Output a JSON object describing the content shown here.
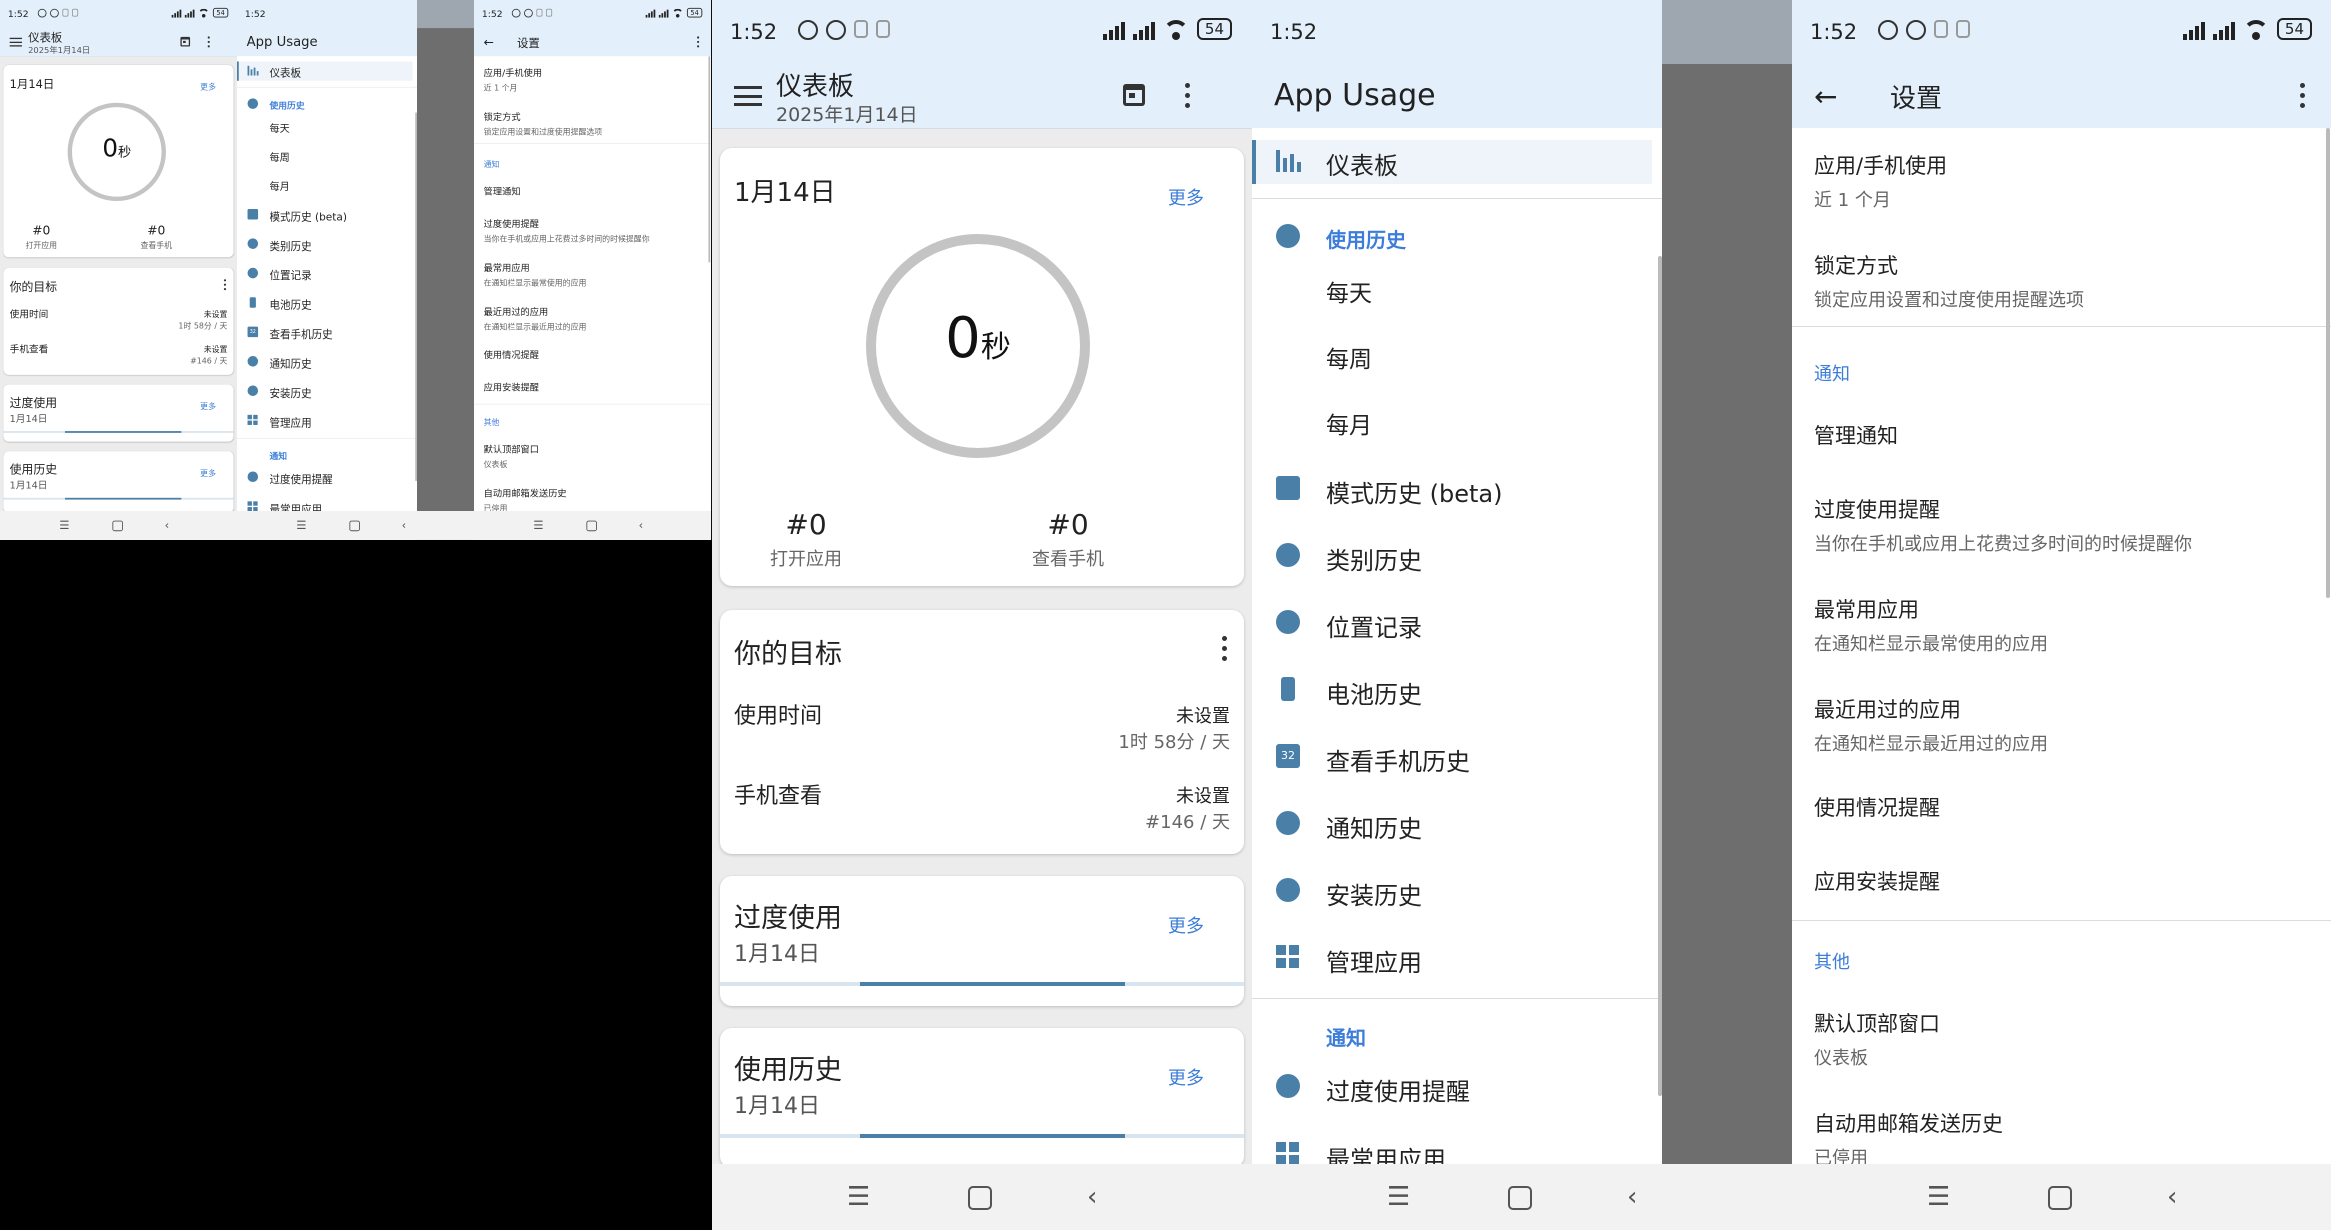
{
  "status": {
    "time": "1:52",
    "battery": "54"
  },
  "dashboard": {
    "title": "仪表板",
    "date_sub": "2025年1月14日",
    "today": {
      "date": "1月14日",
      "more": "更多",
      "value": "0",
      "unit": "秒",
      "opens_num": "#0",
      "opens_label": "打开应用",
      "checks_num": "#0",
      "checks_label": "查看手机"
    },
    "goals": {
      "title": "你的目标",
      "usage_label": "使用时间",
      "usage_status": "未设置",
      "usage_sub": "1时 58分 / 天",
      "checks_label": "手机查看",
      "checks_status": "未设置",
      "checks_sub": "#146 / 天"
    },
    "overuse": {
      "title": "过度使用",
      "date": "1月14日",
      "more": "更多"
    },
    "history": {
      "title": "使用历史",
      "date": "1月14日",
      "more": "更多"
    }
  },
  "drawer": {
    "title": "App Usage",
    "items": [
      {
        "label": "仪表板"
      },
      {
        "label": "使用历史"
      },
      {
        "label": "每天"
      },
      {
        "label": "每周"
      },
      {
        "label": "每月"
      },
      {
        "label": "模式历史 (beta)"
      },
      {
        "label": "类别历史"
      },
      {
        "label": "位置记录"
      },
      {
        "label": "电池历史"
      },
      {
        "label": "查看手机历史"
      },
      {
        "label": "通知历史"
      },
      {
        "label": "安装历史"
      },
      {
        "label": "管理应用"
      },
      {
        "label": "通知"
      },
      {
        "label": "过度使用提醒"
      },
      {
        "label": "最常用应用"
      }
    ],
    "calendar_badge": "32"
  },
  "settings": {
    "title": "设置",
    "items": [
      {
        "title": "应用/手机使用",
        "summary": "近 1 个月"
      },
      {
        "title": "锁定方式",
        "summary": "锁定应用设置和过度使用提醒选项"
      },
      {
        "title": "管理通知",
        "summary": ""
      },
      {
        "title": "过度使用提醒",
        "summary": "当你在手机或应用上花费过多时间的时候提醒你"
      },
      {
        "title": "最常用应用",
        "summary": "在通知栏显示最常使用的应用"
      },
      {
        "title": "最近用过的应用",
        "summary": "在通知栏显示最近用过的应用"
      },
      {
        "title": "使用情况提醒",
        "summary": ""
      },
      {
        "title": "应用安装提醒",
        "summary": ""
      },
      {
        "title": "默认顶部窗口",
        "summary": "仪表板"
      },
      {
        "title": "自动用邮箱发送历史",
        "summary": "已停用"
      }
    ],
    "sections": {
      "notify": "通知",
      "other": "其他"
    }
  },
  "colors": {
    "accent": "#3b7dd8",
    "appbar": "#e3f0fb",
    "bar": "#4a7fa8"
  }
}
